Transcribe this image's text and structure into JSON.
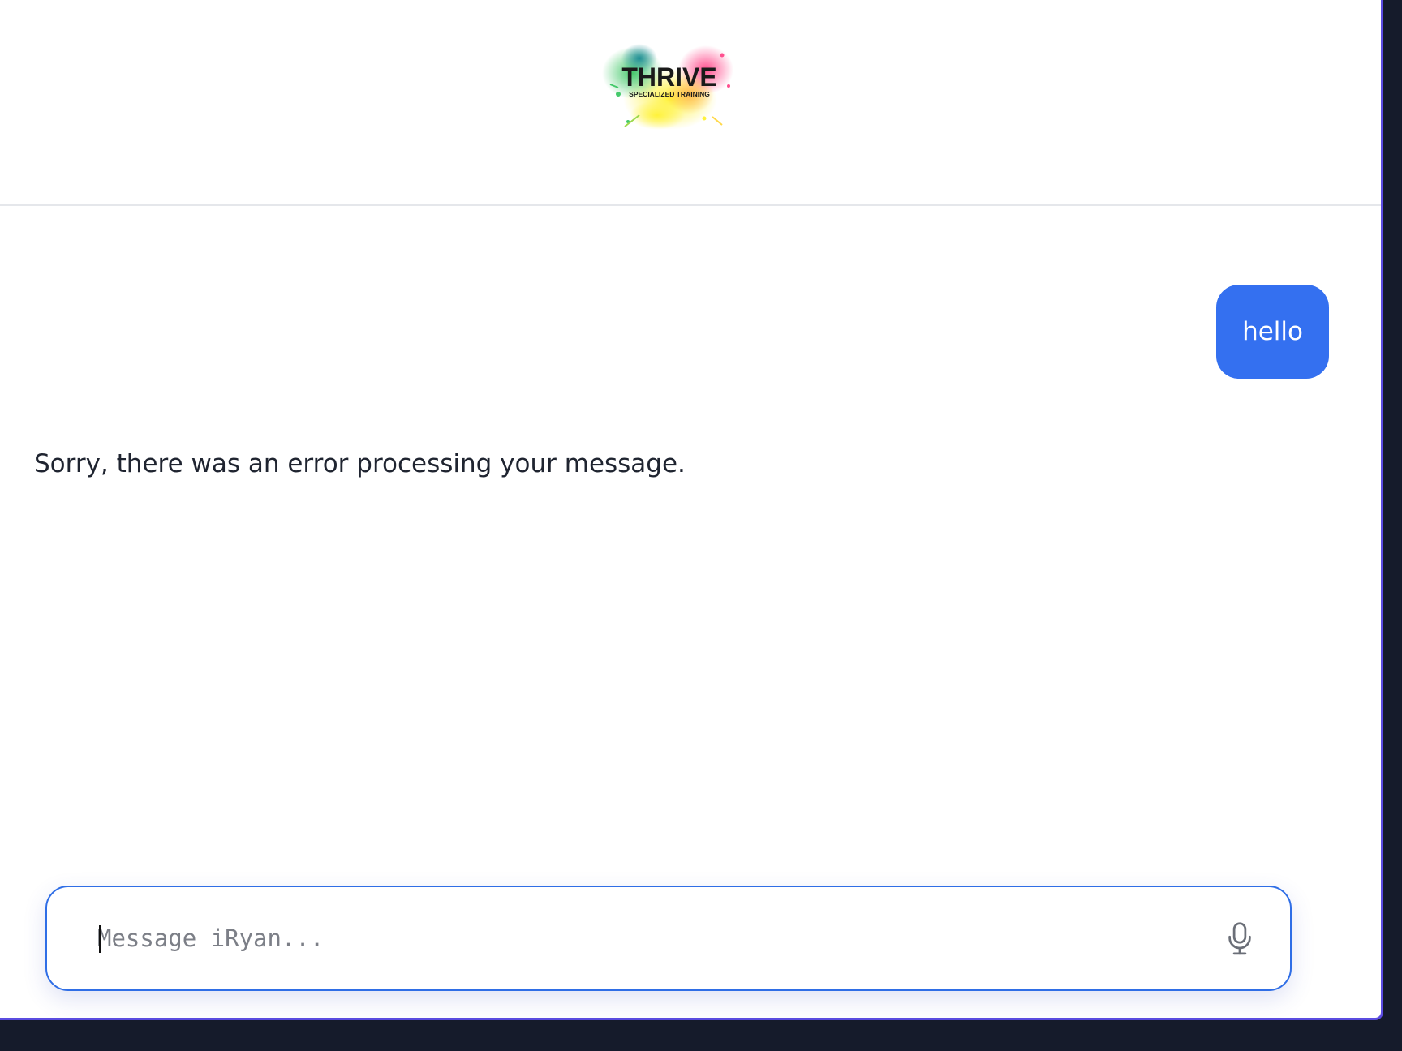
{
  "header": {
    "logo": {
      "name": "thrive-logo",
      "title": "THRIVE",
      "subtitle": "SPECIALIZED TRAINING"
    }
  },
  "chat": {
    "messages": [
      {
        "role": "user",
        "text": "hello"
      },
      {
        "role": "assistant",
        "text": "Sorry, there was an error processing your message."
      }
    ]
  },
  "composer": {
    "placeholder": "Message iRyan...",
    "value": "",
    "mic_icon": "microphone-icon"
  },
  "colors": {
    "accent": "#3470f0",
    "window_border": "#5b4ce0",
    "background": "#151b2b",
    "text": "#1f2430"
  }
}
